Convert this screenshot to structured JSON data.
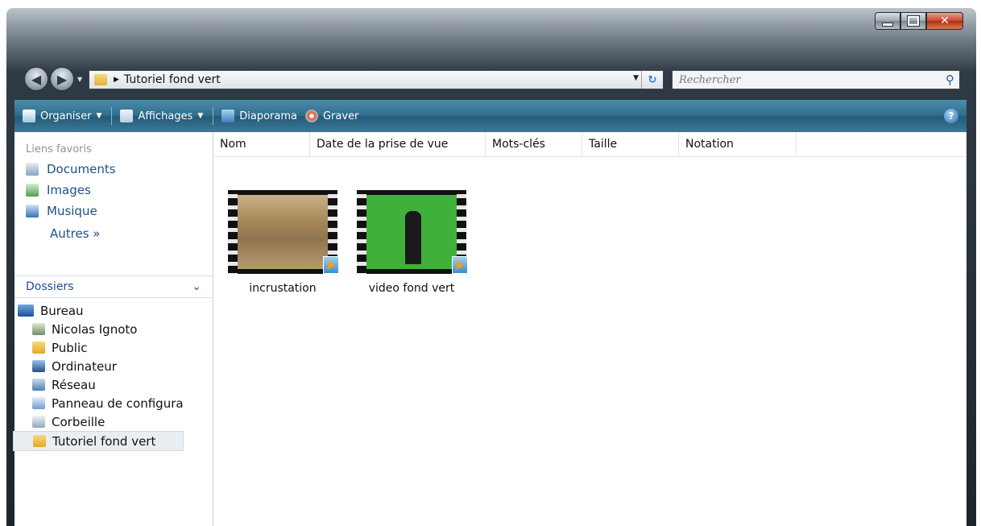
{
  "address": {
    "path": "Tutoriel fond vert"
  },
  "search": {
    "placeholder": "Rechercher"
  },
  "toolbar": {
    "organize": "Organiser",
    "views": "Affichages",
    "slideshow": "Diaporama",
    "burn": "Graver"
  },
  "sidebar": {
    "favorites_header": "Liens favoris",
    "favorites": [
      {
        "label": "Documents",
        "icon": "documents-icon"
      },
      {
        "label": "Images",
        "icon": "images-icon"
      },
      {
        "label": "Musique",
        "icon": "music-icon"
      }
    ],
    "more_label": "Autres »",
    "folders_header": "Dossiers",
    "tree": [
      {
        "label": "Bureau",
        "icon": "desktop-icon"
      },
      {
        "label": "Nicolas Ignoto",
        "icon": "user-folder-icon"
      },
      {
        "label": "Public",
        "icon": "folder-icon"
      },
      {
        "label": "Ordinateur",
        "icon": "computer-icon"
      },
      {
        "label": "Réseau",
        "icon": "network-icon"
      },
      {
        "label": "Panneau de configura",
        "icon": "control-panel-icon"
      },
      {
        "label": "Corbeille",
        "icon": "recycle-bin-icon"
      },
      {
        "label": "Tutoriel fond vert",
        "icon": "folder-icon",
        "selected": true
      }
    ]
  },
  "columns": [
    "Nom",
    "Date de la prise de vue",
    "Mots-clés",
    "Taille",
    "Notation"
  ],
  "files": [
    {
      "name": "incrustation",
      "type": "video"
    },
    {
      "name": "video fond vert",
      "type": "video"
    }
  ],
  "colors": {
    "toolbar": "#2f6d8d",
    "link": "#1f4e8c",
    "green_screen": "#3fb03a"
  }
}
